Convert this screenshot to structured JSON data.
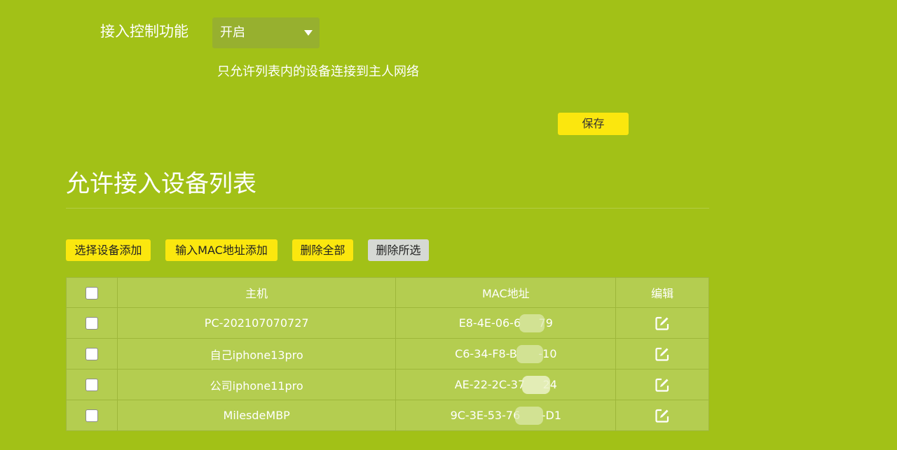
{
  "access_control": {
    "label": "接入控制功能",
    "selected": "开启",
    "description": "只允许列表内的设备连接到主人网络",
    "save_label": "保存"
  },
  "section": {
    "title": "允许接入设备列表"
  },
  "toolbar": {
    "select_add": "选择设备添加",
    "mac_add": "输入MAC地址添加",
    "delete_all": "删除全部",
    "delete_selected": "删除所选"
  },
  "table": {
    "headers": {
      "host": "主机",
      "mac": "MAC地址",
      "edit": "编辑"
    },
    "rows": [
      {
        "host": "PC-202107070727",
        "mac": "E8-4E-06-6     79"
      },
      {
        "host": "自己iphone13pro",
        "mac": "C6-34-F8-B      -10"
      },
      {
        "host": "公司iphone11pro",
        "mac": "AE-22-2C-37     24"
      },
      {
        "host": "MilesdeMBP",
        "mac": "9C-3E-53-76      -D1"
      }
    ]
  },
  "icons": {
    "dropdown": "chevron-down-icon",
    "edit": "edit-icon",
    "checkbox": "checkbox"
  },
  "colors": {
    "background": "#a2c117",
    "button_yellow": "#fbe70e",
    "button_gray": "#d6d9d4",
    "table_fill": "#b4cd50"
  }
}
